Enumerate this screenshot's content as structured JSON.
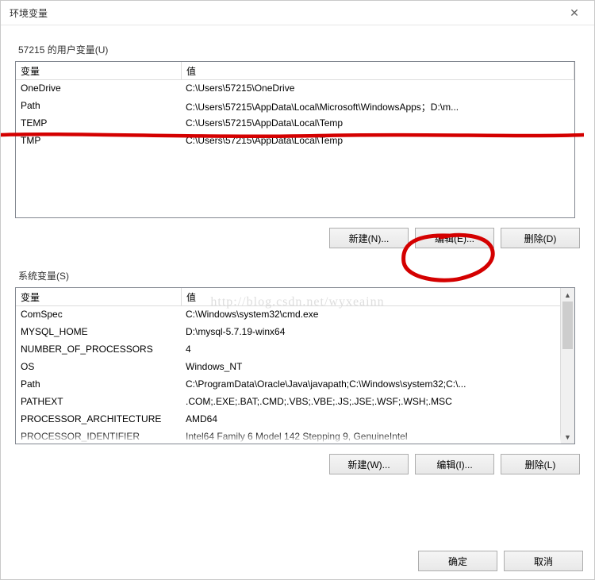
{
  "window": {
    "title": "环境变量",
    "close": "✕"
  },
  "user": {
    "heading": "57215 的用户变量(U)",
    "col_var": "变量",
    "col_val": "值",
    "rows": [
      {
        "var": "OneDrive",
        "val": "C:\\Users\\57215\\OneDrive"
      },
      {
        "var": "Path",
        "val": "C:\\Users\\57215\\AppData\\Local\\Microsoft\\WindowsApps；D:\\m..."
      },
      {
        "var": "TEMP",
        "val": "C:\\Users\\57215\\AppData\\Local\\Temp"
      },
      {
        "var": "TMP",
        "val": "C:\\Users\\57215\\AppData\\Local\\Temp"
      }
    ],
    "btn_new": "新建(N)...",
    "btn_edit": "编辑(E)...",
    "btn_delete": "删除(D)"
  },
  "sys": {
    "heading": "系统变量(S)",
    "col_var": "变量",
    "col_val": "值",
    "rows": [
      {
        "var": "ComSpec",
        "val": "C:\\Windows\\system32\\cmd.exe"
      },
      {
        "var": "MYSQL_HOME",
        "val": "D:\\mysql-5.7.19-winx64"
      },
      {
        "var": "NUMBER_OF_PROCESSORS",
        "val": "4"
      },
      {
        "var": "OS",
        "val": "Windows_NT"
      },
      {
        "var": "Path",
        "val": "C:\\ProgramData\\Oracle\\Java\\javapath;C:\\Windows\\system32;C:\\..."
      },
      {
        "var": "PATHEXT",
        "val": ".COM;.EXE;.BAT;.CMD;.VBS;.VBE;.JS;.JSE;.WSF;.WSH;.MSC"
      },
      {
        "var": "PROCESSOR_ARCHITECTURE",
        "val": "AMD64"
      },
      {
        "var": "PROCESSOR_IDENTIFIER",
        "val": "Intel64 Family 6 Model 142 Stepping 9, GenuineIntel"
      }
    ],
    "btn_new": "新建(W)...",
    "btn_edit": "编辑(I)...",
    "btn_delete": "删除(L)"
  },
  "footer": {
    "ok": "确定",
    "cancel": "取消"
  },
  "watermark": "http://blog.csdn.net/wyxeainn"
}
